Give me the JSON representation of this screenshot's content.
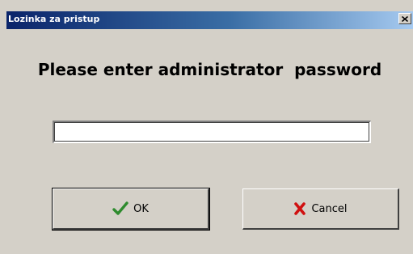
{
  "window": {
    "title": "Lozinka za pristup"
  },
  "dialog": {
    "prompt": "Please enter administrator  password",
    "password_value": ""
  },
  "buttons": {
    "ok_label": "OK",
    "cancel_label": "Cancel"
  },
  "icons": {
    "close": "close-icon",
    "ok": "checkmark-icon",
    "cancel": "x-mark-icon"
  },
  "colors": {
    "title_bar_start": "#0a246a",
    "title_bar_end": "#a6caf0",
    "dialog_face": "#d4d0c8",
    "ok_icon": "#2e8b2e",
    "cancel_icon": "#d01010"
  }
}
